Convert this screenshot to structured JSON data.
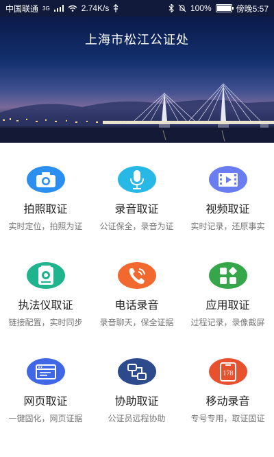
{
  "status_bar": {
    "carrier": "中国联通",
    "network": "3G",
    "speed": "2.74K/s",
    "battery": "100%",
    "time": "傍晚5:57"
  },
  "header": {
    "title": "上海市松江公证处"
  },
  "services": [
    {
      "label": "拍照取证",
      "sub": "实时定位，拍照为证",
      "icon": "camera-icon",
      "color": "#2a8ff0"
    },
    {
      "label": "录音取证",
      "sub": "公证保全，录音为证",
      "icon": "microphone-icon",
      "color": "#27b8e6"
    },
    {
      "label": "视频取证",
      "sub": "实时记录，还原事实",
      "icon": "video-icon",
      "color": "#6a7df0"
    },
    {
      "label": "执法仪取证",
      "sub": "链接配置，实时同步",
      "icon": "body-camera-icon",
      "color": "#1fb38e"
    },
    {
      "label": "电话录音",
      "sub": "录音聊天，保全证据",
      "icon": "phone-icon",
      "color": "#f2692f"
    },
    {
      "label": "应用取证",
      "sub": "过程记录，录像截屏",
      "icon": "apps-icon",
      "color": "#35a64a"
    },
    {
      "label": "网页取证",
      "sub": "一键固化，网页证据",
      "icon": "webpage-icon",
      "color": "#3f67e6"
    },
    {
      "label": "协助取证",
      "sub": "公证员远程协助",
      "icon": "assist-icon",
      "color": "#2c4a8c"
    },
    {
      "label": "移动录音",
      "sub": "专号专用，取证固证",
      "icon": "mobile-recording-icon",
      "color": "#e8512e",
      "badge": "178"
    }
  ]
}
